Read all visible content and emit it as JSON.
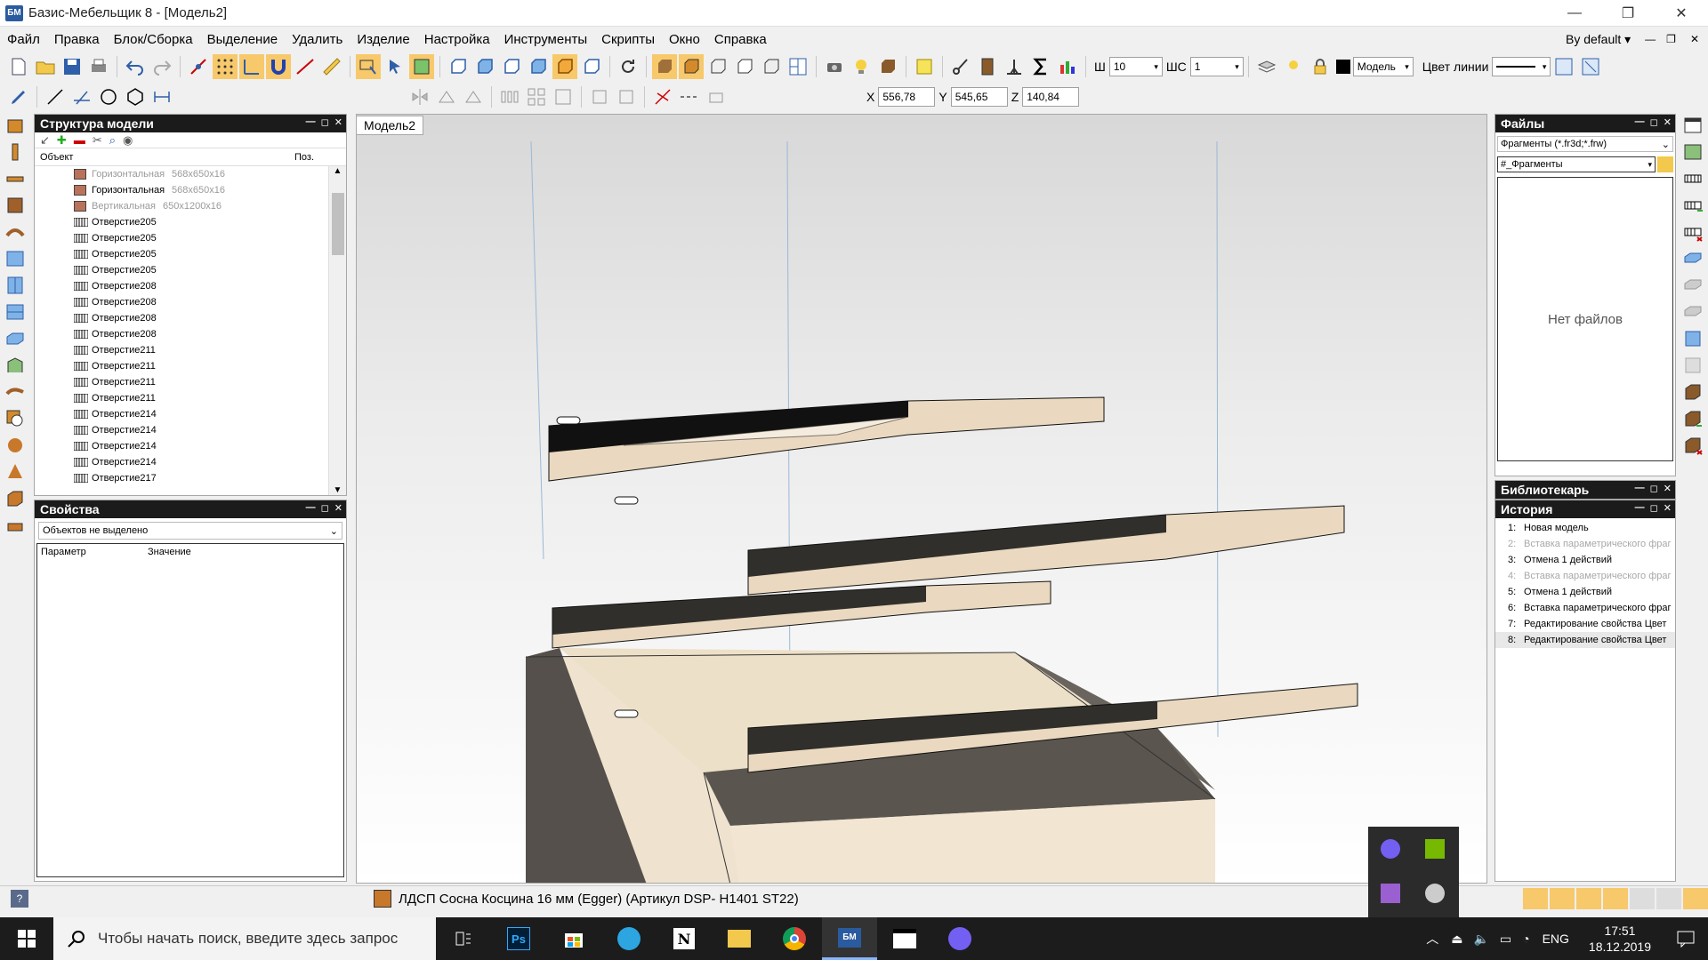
{
  "window": {
    "title": "Базис-Мебельщик 8 - [Модель2]",
    "app_icon": "bazis-icon"
  },
  "menu": {
    "items": [
      "Файл",
      "Правка",
      "Блок/Сборка",
      "Выделение",
      "Удалить",
      "Изделие",
      "Настройка",
      "Инструменты",
      "Скрипты",
      "Окно",
      "Справка"
    ],
    "profile": "By default"
  },
  "toolbar": {
    "sh_label": "Ш",
    "sh_value": "10",
    "shc_label": "ШС",
    "shc_value": "1",
    "layer_value": "Модель",
    "line_color_label": "Цвет линии",
    "x_label": "X",
    "x_value": "556,78",
    "y_label": "Y",
    "y_value": "545,65",
    "z_label": "Z",
    "z_value": "140,84"
  },
  "structure_panel": {
    "title": "Структура модели",
    "col_object": "Объект",
    "col_pos": "Поз.",
    "rows": [
      {
        "label": "Горизонтальная",
        "dims": "568x650x16",
        "dim": true,
        "icon": "panel"
      },
      {
        "label": "Горизонтальная",
        "dims": "568x650x16",
        "dim": false,
        "icon": "panel"
      },
      {
        "label": "Вертикальная",
        "dims": "650x1200x16",
        "dim": true,
        "icon": "panel"
      },
      {
        "label": "Отверстие205",
        "icon": "hole"
      },
      {
        "label": "Отверстие205",
        "icon": "hole"
      },
      {
        "label": "Отверстие205",
        "icon": "hole"
      },
      {
        "label": "Отверстие205",
        "icon": "hole"
      },
      {
        "label": "Отверстие208",
        "icon": "hole"
      },
      {
        "label": "Отверстие208",
        "icon": "hole"
      },
      {
        "label": "Отверстие208",
        "icon": "hole"
      },
      {
        "label": "Отверстие208",
        "icon": "hole"
      },
      {
        "label": "Отверстие211",
        "icon": "hole"
      },
      {
        "label": "Отверстие211",
        "icon": "hole"
      },
      {
        "label": "Отверстие211",
        "icon": "hole"
      },
      {
        "label": "Отверстие211",
        "icon": "hole"
      },
      {
        "label": "Отверстие214",
        "icon": "hole"
      },
      {
        "label": "Отверстие214",
        "icon": "hole"
      },
      {
        "label": "Отверстие214",
        "icon": "hole"
      },
      {
        "label": "Отверстие214",
        "icon": "hole"
      },
      {
        "label": "Отверстие217",
        "icon": "hole"
      }
    ]
  },
  "properties_panel": {
    "title": "Свойства",
    "selection": "Объектов не выделено",
    "col_param": "Параметр",
    "col_value": "Значение"
  },
  "viewport": {
    "tab": "Модель2"
  },
  "files_panel": {
    "title": "Файлы",
    "filter": "Фрагменты (*.fr3d;*.frw)",
    "folder": "#_Фрагменты",
    "empty_text": "Нет файлов"
  },
  "librarian_panel": {
    "title": "Библиотекарь"
  },
  "history_panel": {
    "title": "История",
    "items": [
      {
        "n": "1:",
        "label": "Новая модель",
        "dim": false
      },
      {
        "n": "2:",
        "label": "Вставка параметрического фраг",
        "dim": true
      },
      {
        "n": "3:",
        "label": "Отмена 1 действий",
        "dim": false
      },
      {
        "n": "4:",
        "label": "Вставка параметрического фраг",
        "dim": true
      },
      {
        "n": "5:",
        "label": "Отмена 1 действий",
        "dim": false
      },
      {
        "n": "6:",
        "label": "Вставка параметрического фраг",
        "dim": false
      },
      {
        "n": "7:",
        "label": "Редактирование свойства Цвет",
        "dim": false
      },
      {
        "n": "8:",
        "label": "Редактирование свойства Цвет",
        "dim": false,
        "selected": true
      }
    ]
  },
  "statusbar": {
    "material": "ЛДСП Сосна Косцина 16 мм (Egger) (Артикул DSP- H1401 ST22)"
  },
  "taskbar": {
    "search_placeholder": "Чтобы начать поиск, введите здесь запрос",
    "lang": "ENG",
    "time": "17:51",
    "date": "18.12.2019"
  },
  "colors": {
    "panel_header": "#1b1b1b",
    "wood": "#e8dcc8",
    "dark_wood": "#4a4440"
  }
}
